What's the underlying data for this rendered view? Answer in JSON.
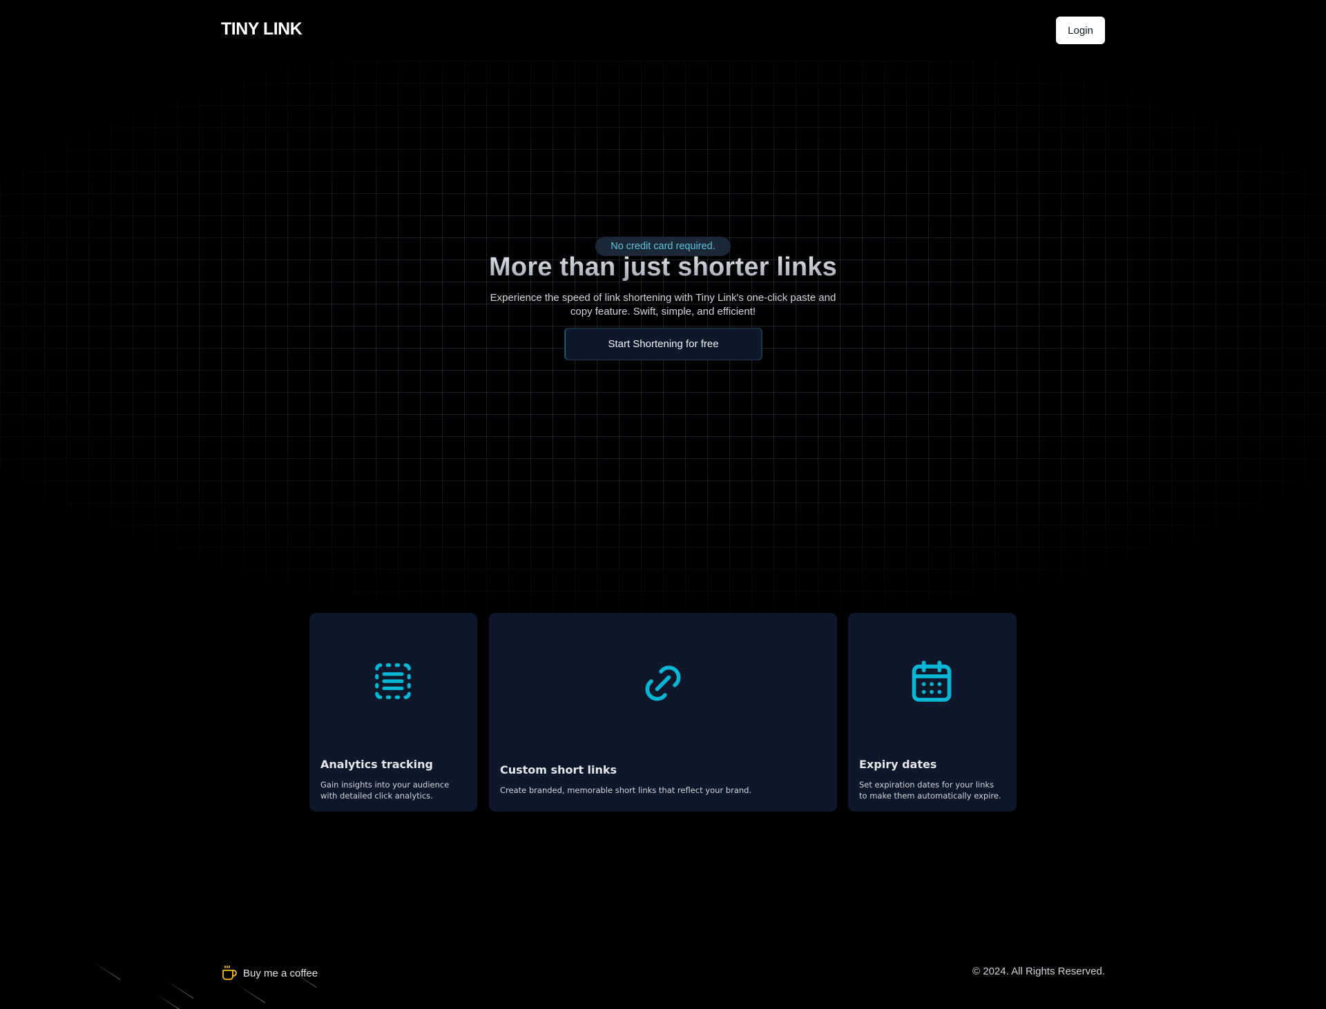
{
  "header": {
    "logo": "TINY LINK",
    "login_label": "Login"
  },
  "hero": {
    "badge": "No credit card required.",
    "title": "More than just shorter links",
    "subtitle": "Experience the speed of link shortening with Tiny Link's one-click paste and copy feature. Swift, simple, and efficient!",
    "cta_label": "Start Shortening for free"
  },
  "features": [
    {
      "icon": "dashed-list-icon",
      "title": "Analytics tracking",
      "description": "Gain insights into your audience with detailed click analytics."
    },
    {
      "icon": "link-icon",
      "title": "Custom short links",
      "description": "Create branded, memorable short links that reflect your brand."
    },
    {
      "icon": "calendar-icon",
      "title": "Expiry dates",
      "description": "Set expiration dates for your links to make them automatically expire."
    }
  ],
  "footer": {
    "coffee_label": "Buy me a coffee",
    "coffee_icon": "coffee-cup-icon",
    "copyright": "© 2024. All Rights Reserved."
  },
  "colors": {
    "background": "#000000",
    "card": "#0f172a",
    "accent": "#06b6d4",
    "coffee": "#fbbf24"
  }
}
